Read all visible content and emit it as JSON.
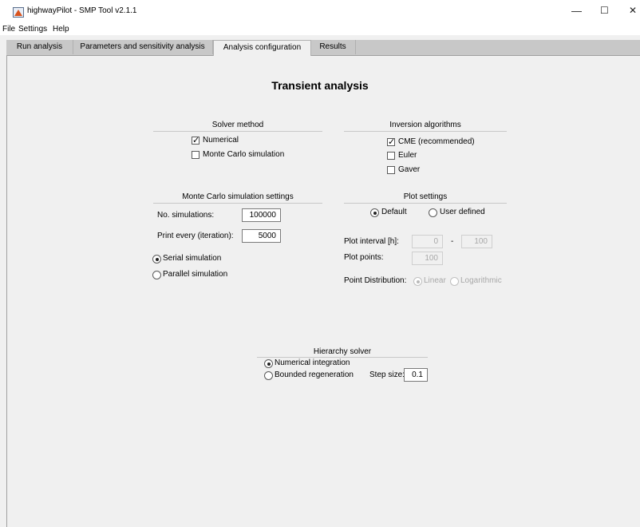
{
  "window": {
    "title": "highwayPilot - SMP Tool v2.1.1",
    "controls": {
      "minimize": "—",
      "maximize": "☐",
      "close": "✕"
    }
  },
  "menu": [
    "File",
    "Settings",
    "Help"
  ],
  "tabs": [
    {
      "label": "Run analysis",
      "active": false
    },
    {
      "label": "Parameters and sensitivity analysis",
      "active": false
    },
    {
      "label": "Analysis configuration",
      "active": true
    },
    {
      "label": "Results",
      "active": false
    }
  ],
  "page_title": "Transient analysis",
  "solver_method": {
    "title": "Solver method",
    "options": [
      {
        "label": "Numerical",
        "checked": true
      },
      {
        "label": "Monte Carlo simulation",
        "checked": false
      }
    ]
  },
  "inversion_algorithms": {
    "title": "Inversion algorithms",
    "options": [
      {
        "label": "CME (recommended)",
        "checked": true
      },
      {
        "label": "Euler",
        "checked": false
      },
      {
        "label": "Gaver",
        "checked": false
      }
    ]
  },
  "monte_carlo": {
    "title": "Monte Carlo simulation settings",
    "num_sim_label": "No. simulations:",
    "num_sim_value": "100000",
    "print_every_label": "Print every (iteration):",
    "print_every_value": "5000",
    "modes": [
      {
        "label": "Serial simulation",
        "selected": true
      },
      {
        "label": "Parallel simulation",
        "selected": false
      }
    ]
  },
  "plot_settings": {
    "title": "Plot settings",
    "modes": [
      {
        "label": "Default",
        "selected": true
      },
      {
        "label": "User defined",
        "selected": false
      }
    ],
    "interval_label": "Plot interval [h]:",
    "interval_from": "0",
    "interval_sep": "-",
    "interval_to": "100",
    "points_label": "Plot points:",
    "points_value": "100",
    "distribution_label": "Point Distribution:",
    "distribution_options": [
      {
        "label": "Linear",
        "selected": true
      },
      {
        "label": "Logarithmic",
        "selected": false
      }
    ]
  },
  "hierarchy_solver": {
    "title": "Hierarchy solver",
    "options": [
      {
        "label": "Numerical integration",
        "selected": true
      },
      {
        "label": "Bounded regeneration",
        "selected": false
      }
    ],
    "step_size_label": "Step size:",
    "step_size_value": "0.1"
  }
}
